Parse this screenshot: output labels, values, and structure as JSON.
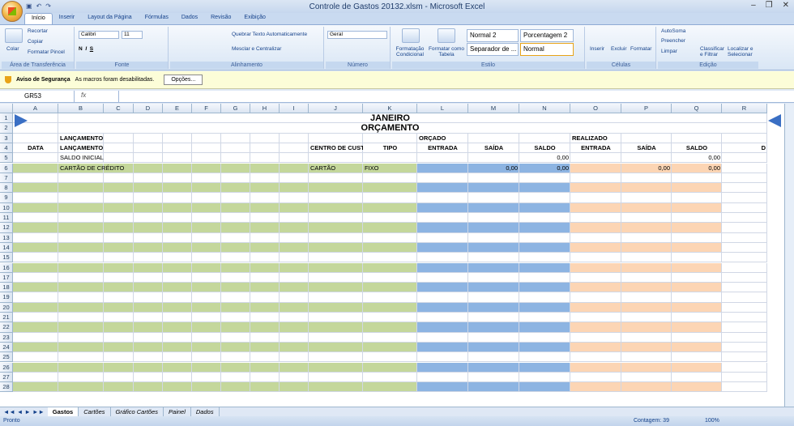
{
  "window": {
    "title": "Controle de Gastos 20132.xlsm - Microsoft Excel",
    "qat_save": "▣",
    "qat_undo": "↶",
    "qat_redo": "↷"
  },
  "tabs": [
    "Início",
    "Inserir",
    "Layout da Página",
    "Fórmulas",
    "Dados",
    "Revisão",
    "Exibição"
  ],
  "ribbon": {
    "clipboard": {
      "colar": "Colar",
      "recortar": "Recortar",
      "copiar": "Copiar",
      "formatar_pincel": "Formatar Pincel",
      "label": "Área de Transferência"
    },
    "font": {
      "name": "Calibri",
      "size": "11",
      "label": "Fonte"
    },
    "alignment": {
      "wrap": "Quebrar Texto Automaticamente",
      "merge": "Mesclar e Centralizar",
      "label": "Alinhamento"
    },
    "number": {
      "format": "Geral",
      "label": "Número"
    },
    "style": {
      "cond": "Formatação Condicional",
      "table": "Formatar como Tabela",
      "s1": "Normal 2",
      "s2": "Porcentagem 2",
      "s3": "Separador de ...",
      "s4": "Normal",
      "label": "Estilo"
    },
    "cells": {
      "insert": "Inserir",
      "delete": "Excluir",
      "format": "Formatar",
      "label": "Células"
    },
    "edit": {
      "autosum": "AutoSoma",
      "fill": "Preencher",
      "clear": "Limpar",
      "sort": "Classificar e Filtrar",
      "find": "Localizar e Selecionar",
      "label": "Edição"
    }
  },
  "security": {
    "title": "Aviso de Segurança",
    "message": "As macros foram desabilitadas.",
    "button": "Opções..."
  },
  "formula_bar": {
    "name_box": "GR53",
    "fx": "fx",
    "content": ""
  },
  "columns": [
    "A",
    "B",
    "C",
    "D",
    "E",
    "F",
    "G",
    "H",
    "I",
    "J",
    "K",
    "L",
    "M",
    "N",
    "O",
    "P",
    "Q",
    "R"
  ],
  "rows": [
    "1",
    "2",
    "3",
    "4",
    "5",
    "6",
    "7",
    "8",
    "9",
    "10",
    "11",
    "12",
    "13",
    "14",
    "15",
    "16",
    "17",
    "18",
    "19",
    "20",
    "21",
    "22",
    "23",
    "24",
    "25",
    "26",
    "27",
    "28"
  ],
  "sheet": {
    "title": "JANEIRO",
    "subtitle": "ORÇAMENTO",
    "lancamento_hdr": "LANÇAMENTO",
    "orcado": "ORÇADO",
    "realizado": "REALIZADO",
    "headers": {
      "data": "DATA",
      "lancamento": "LANÇAMENTO",
      "centro": "CENTRO DE CUSTO",
      "tipo": "TIPO",
      "entrada": "ENTRADA",
      "saida": "SAÍDA",
      "saldo": "SALDO",
      "entrada2": "ENTRADA",
      "saida2": "SAÍDA",
      "saldo2": "SALDO",
      "d": "D"
    },
    "row5": {
      "label": "SALDO INICIAL",
      "saldo": "0,00",
      "saldo2": "0,00"
    },
    "row6": {
      "label": "CARTÃO DE CRÉDITO",
      "centro": "CARTÃO",
      "tipo": "FIXO",
      "saida": "0,00",
      "saldo": "0,00",
      "saida2": "0,00",
      "saldo2": "0,00"
    }
  },
  "sheet_tabs": [
    "Gastos",
    "Cartões",
    "Gráfico Cartões",
    "Painel",
    "Dados"
  ],
  "status": {
    "ready": "Pronto",
    "count": "Contagem: 39",
    "zoom": "100%"
  },
  "colors": {
    "green": "#c4d79b",
    "blue": "#8db4e2",
    "orange": "#fcd5b4"
  }
}
